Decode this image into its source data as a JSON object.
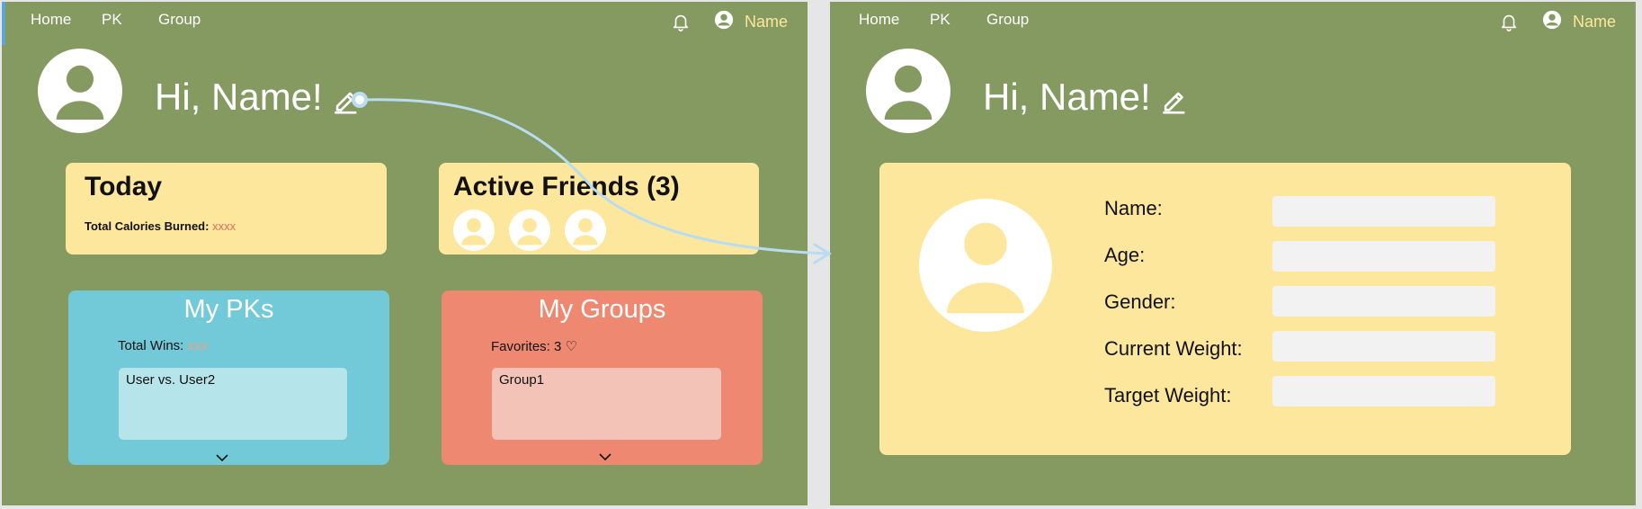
{
  "colors": {
    "frame_bg": "#859a61",
    "yellow_card": "#fde79c",
    "blue_card": "#72c9d7",
    "blue_inner": "#b5e5eb",
    "red_card": "#ee8870",
    "red_inner": "#f4c3b8",
    "accent_name": "#fde79c",
    "calorie_value": "#e56b5b",
    "arrow": "#b9dcf1"
  },
  "nav": {
    "home": "Home",
    "pk": "PK",
    "group": "Group",
    "user_name": "Name",
    "bell_icon": "bell-icon",
    "user_icon": "user-circle-icon"
  },
  "left": {
    "greeting": "Hi, Name!",
    "today": {
      "title": "Today",
      "calories_label": "Total Calories Burned: ",
      "calories_value": "xxxx"
    },
    "active_friends": {
      "title": "Active Friends (3)",
      "count": 3
    },
    "my_pks": {
      "title": "My PKs",
      "wins_label": "Total Wins: ",
      "wins_value": "xxx",
      "items": [
        "User vs. User2"
      ]
    },
    "my_groups": {
      "title": "My Groups",
      "favorites_label": "Favorites: 3 ♡",
      "items": [
        "Group1"
      ]
    }
  },
  "right": {
    "greeting": "Hi, Name!",
    "profile_form": {
      "fields": [
        {
          "label": "Name:",
          "value": ""
        },
        {
          "label": "Age:",
          "value": ""
        },
        {
          "label": "Gender:",
          "value": ""
        },
        {
          "label": "Current Weight:",
          "value": ""
        },
        {
          "label": "Target Weight:",
          "value": ""
        }
      ]
    }
  }
}
